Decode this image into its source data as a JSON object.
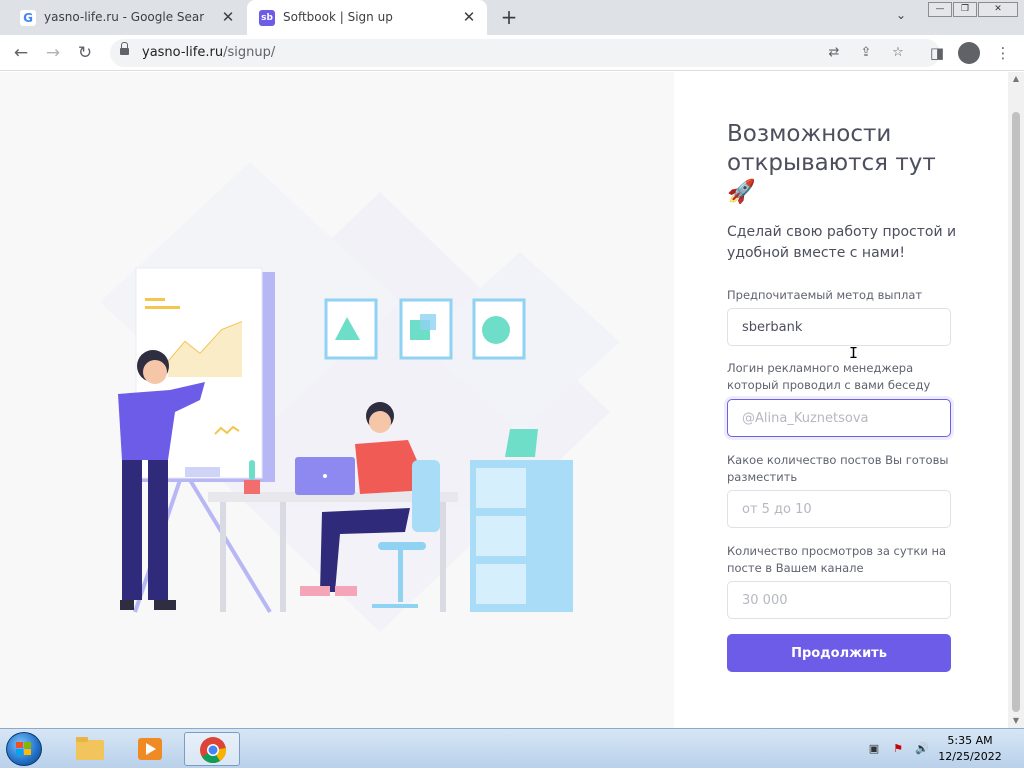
{
  "browser": {
    "tabs": [
      {
        "title": "yasno-life.ru - Google Search",
        "favicon": "G"
      },
      {
        "title": "Softbook | Sign up",
        "favicon": "sb"
      }
    ],
    "url": {
      "host": "yasno-life.ru",
      "path": "/signup/"
    }
  },
  "form": {
    "title": "Возможности открываются тут 🚀",
    "subtitle": "Сделай свою работу простой и удобной вместе с нами!",
    "fields": [
      {
        "label": "Предпочитаемый метод выплат",
        "value": "sberbank",
        "placeholder": ""
      },
      {
        "label": "Логин рекламного менеджера который проводил с вами беседу",
        "value": "",
        "placeholder": "@Alina_Kuznetsova"
      },
      {
        "label": "Какое количество постов Вы готовы разместить",
        "value": "",
        "placeholder": "от 5 до 10"
      },
      {
        "label": "Количество просмотров за сутки на посте в Вашем канале",
        "value": "",
        "placeholder": "30 000"
      }
    ],
    "submit_label": "Продолжить"
  },
  "taskbar": {
    "time": "5:35 AM",
    "date": "12/25/2022"
  },
  "colors": {
    "accent": "#6c5ce7",
    "text": "#4d4f5c"
  }
}
